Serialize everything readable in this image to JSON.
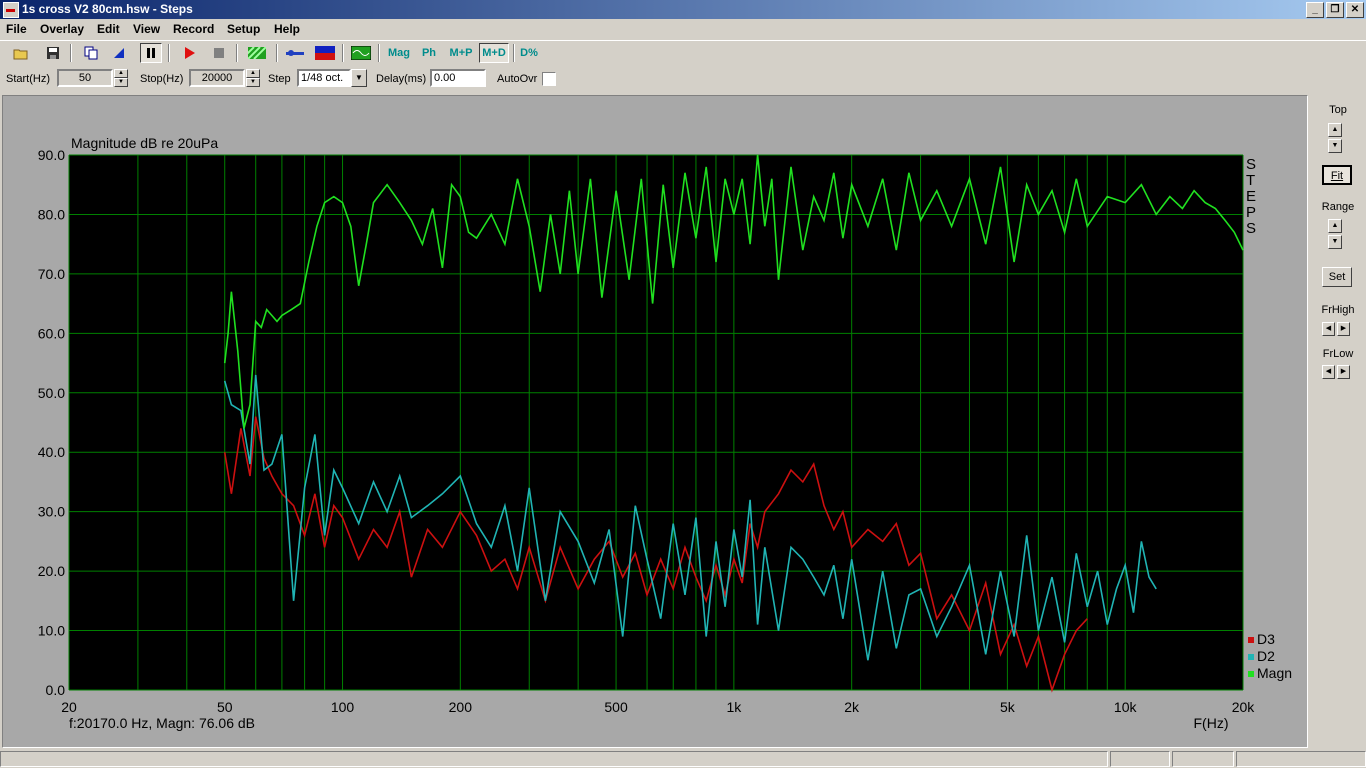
{
  "window": {
    "title": "1s cross V2 80cm.hsw - Steps",
    "minimize": "_",
    "maximize": "❐",
    "close": "✕"
  },
  "menu": [
    "File",
    "Overlay",
    "Edit",
    "View",
    "Record",
    "Setup",
    "Help"
  ],
  "toolbar": {
    "mag": "Mag",
    "ph": "Ph",
    "mp": "M+P",
    "md": "M+D",
    "dpct": "D%"
  },
  "params": {
    "start_label": "Start(Hz)",
    "start_value": "50",
    "stop_label": "Stop(Hz)",
    "stop_value": "20000",
    "step_label": "Step",
    "step_value": "1/48 oct.",
    "delay_label": "Delay(ms)",
    "delay_value": "0.00",
    "autoovr_label": "AutoOvr"
  },
  "right_panel": {
    "top": "Top",
    "fit": "Fit",
    "range": "Range",
    "set": "Set",
    "frhigh": "FrHigh",
    "frlow": "FrLow"
  },
  "plot": {
    "side_label": [
      "S",
      "T",
      "E",
      "P",
      "S"
    ],
    "readout": "f:20170.0 Hz, Magn: 76.06 dB",
    "background": "#000000",
    "grid_color": "#008000"
  },
  "chart_data": {
    "type": "line",
    "ylabel": "Magnitude dB re 20uPa",
    "xlabel": "F(Hz)",
    "x_scale": "log",
    "xlim": [
      20,
      20000
    ],
    "ylim": [
      0,
      90
    ],
    "x_ticks": [
      {
        "v": 20,
        "label": "20"
      },
      {
        "v": 50,
        "label": "50"
      },
      {
        "v": 100,
        "label": "100"
      },
      {
        "v": 200,
        "label": "200"
      },
      {
        "v": 500,
        "label": "500"
      },
      {
        "v": 1000,
        "label": "1k"
      },
      {
        "v": 2000,
        "label": "2k"
      },
      {
        "v": 5000,
        "label": "5k"
      },
      {
        "v": 10000,
        "label": "10k"
      },
      {
        "v": 20000,
        "label": "20k"
      }
    ],
    "y_ticks": [
      "0.0",
      "10.0",
      "20.0",
      "30.0",
      "40.0",
      "50.0",
      "60.0",
      "70.0",
      "80.0",
      "90.0"
    ],
    "legend_position": "bottom-right",
    "series": [
      {
        "name": "D3",
        "color": "#cc1010",
        "x": [
          50,
          52,
          55,
          58,
          60,
          63,
          66,
          70,
          75,
          80,
          85,
          90,
          95,
          100,
          110,
          120,
          130,
          140,
          150,
          165,
          180,
          200,
          220,
          240,
          260,
          280,
          300,
          330,
          360,
          400,
          440,
          480,
          520,
          560,
          600,
          650,
          700,
          750,
          800,
          850,
          900,
          950,
          1000,
          1050,
          1100,
          1150,
          1200,
          1300,
          1400,
          1500,
          1600,
          1700,
          1800,
          1900,
          2000,
          2200,
          2400,
          2600,
          2800,
          3000,
          3300,
          3600,
          4000,
          4400,
          4800,
          5200,
          5600,
          6000,
          6500,
          7000,
          7500,
          8000
        ],
        "y": [
          40,
          33,
          44,
          36,
          46,
          39,
          36,
          33,
          31,
          26,
          33,
          24,
          31,
          29,
          22,
          27,
          24,
          30,
          19,
          27,
          24,
          30,
          26,
          20,
          22,
          17,
          24,
          15,
          24,
          17,
          22,
          25,
          19,
          23,
          16,
          22,
          17,
          24,
          19,
          15,
          21,
          16,
          22,
          18,
          28,
          24,
          30,
          33,
          37,
          35,
          38,
          31,
          27,
          30,
          24,
          27,
          25,
          28,
          21,
          23,
          12,
          16,
          10,
          18,
          6,
          11,
          4,
          9,
          0,
          6,
          10,
          12
        ]
      },
      {
        "name": "D2",
        "color": "#20b4b4",
        "x": [
          50,
          52,
          55,
          58,
          60,
          63,
          66,
          70,
          75,
          80,
          85,
          90,
          95,
          100,
          110,
          120,
          130,
          140,
          150,
          165,
          180,
          200,
          220,
          240,
          260,
          280,
          300,
          330,
          360,
          400,
          440,
          480,
          520,
          560,
          600,
          650,
          700,
          750,
          800,
          850,
          900,
          950,
          1000,
          1050,
          1100,
          1150,
          1200,
          1300,
          1400,
          1500,
          1600,
          1700,
          1800,
          1900,
          2000,
          2200,
          2400,
          2600,
          2800,
          3000,
          3300,
          3600,
          4000,
          4400,
          4800,
          5200,
          5600,
          6000,
          6500,
          7000,
          7500,
          8000,
          8500,
          9000,
          9500,
          10000,
          10500,
          11000,
          11500,
          12000
        ],
        "y": [
          52,
          48,
          47,
          38,
          53,
          37,
          38,
          43,
          15,
          34,
          43,
          26,
          37,
          34,
          28,
          35,
          30,
          36,
          29,
          31,
          33,
          36,
          28,
          24,
          31,
          20,
          34,
          15,
          30,
          25,
          18,
          27,
          9,
          31,
          22,
          12,
          28,
          16,
          29,
          9,
          25,
          14,
          27,
          19,
          32,
          11,
          24,
          10,
          24,
          22,
          19,
          16,
          21,
          12,
          22,
          5,
          20,
          7,
          16,
          17,
          9,
          14,
          21,
          6,
          20,
          9,
          26,
          10,
          19,
          8,
          23,
          14,
          20,
          11,
          17,
          21,
          13,
          25,
          19,
          17
        ]
      },
      {
        "name": "Magn",
        "color": "#20e020",
        "x": [
          50,
          51,
          52,
          54,
          56,
          58,
          60,
          62,
          64,
          66,
          68,
          70,
          74,
          78,
          82,
          86,
          90,
          95,
          100,
          105,
          110,
          115,
          120,
          130,
          140,
          150,
          160,
          170,
          180,
          190,
          200,
          210,
          220,
          240,
          260,
          280,
          300,
          320,
          340,
          360,
          380,
          400,
          430,
          460,
          500,
          540,
          580,
          620,
          660,
          700,
          750,
          800,
          850,
          900,
          950,
          1000,
          1050,
          1100,
          1150,
          1200,
          1250,
          1300,
          1400,
          1500,
          1600,
          1700,
          1800,
          1900,
          2000,
          2200,
          2400,
          2600,
          2800,
          3000,
          3300,
          3600,
          4000,
          4400,
          4800,
          5200,
          5600,
          6000,
          6500,
          7000,
          7500,
          8000,
          9000,
          10000,
          11000,
          12000,
          13000,
          14000,
          15000,
          16000,
          17000,
          18000,
          19000,
          20000
        ],
        "y": [
          55,
          60,
          67,
          57,
          44,
          48,
          62,
          61,
          64,
          63,
          62,
          63,
          64,
          65,
          72,
          78,
          82,
          83,
          82,
          78,
          68,
          75,
          82,
          85,
          82,
          79,
          75,
          81,
          71,
          85,
          83,
          77,
          76,
          80,
          75,
          86,
          78,
          67,
          80,
          70,
          84,
          70,
          86,
          66,
          84,
          69,
          86,
          65,
          85,
          71,
          87,
          76,
          88,
          72,
          86,
          80,
          86,
          75,
          90,
          78,
          86,
          69,
          88,
          74,
          83,
          79,
          87,
          76,
          85,
          78,
          86,
          74,
          87,
          79,
          84,
          78,
          86,
          75,
          88,
          72,
          85,
          80,
          84,
          77,
          86,
          78,
          83,
          82,
          85,
          80,
          83,
          81,
          84,
          82,
          81,
          79,
          77,
          74
        ]
      }
    ]
  }
}
